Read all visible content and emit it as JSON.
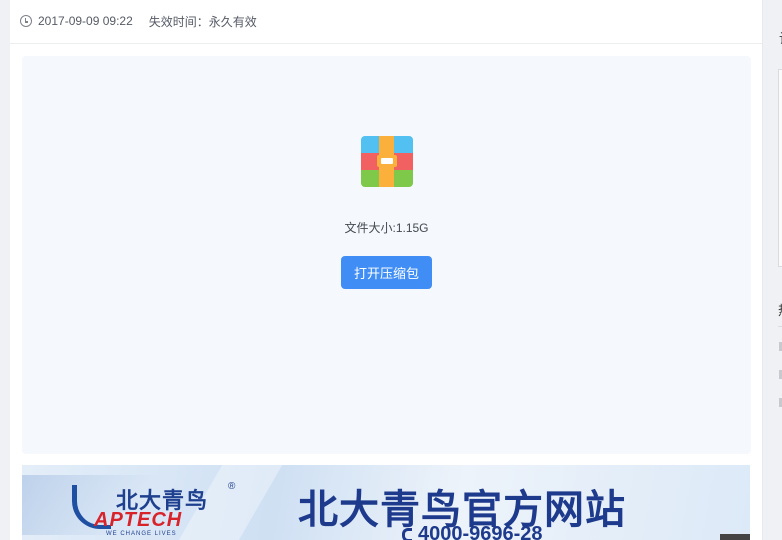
{
  "meta": {
    "date": "2017-09-09 09:22",
    "expire_label": "失效时间：永久有效"
  },
  "file": {
    "size_label": "文件大小:1.15G",
    "open_button": "打开压缩包",
    "icon": "archive-zip-icon"
  },
  "banner": {
    "logo_cn": "北大青鸟",
    "logo_en": "APTECH",
    "logo_tagline": "WE CHANGE LIVES",
    "registered": "®",
    "title": "北大青鸟官方网站",
    "phone": "4000-9696-28"
  },
  "sidebar": {
    "heading1_fragment": "让",
    "heading2_fragment": "热"
  },
  "colors": {
    "accent": "#3f8df5",
    "card_bg": "#f5f8fd",
    "banner_title": "#1d3a8c",
    "logo_red": "#d8232a"
  }
}
